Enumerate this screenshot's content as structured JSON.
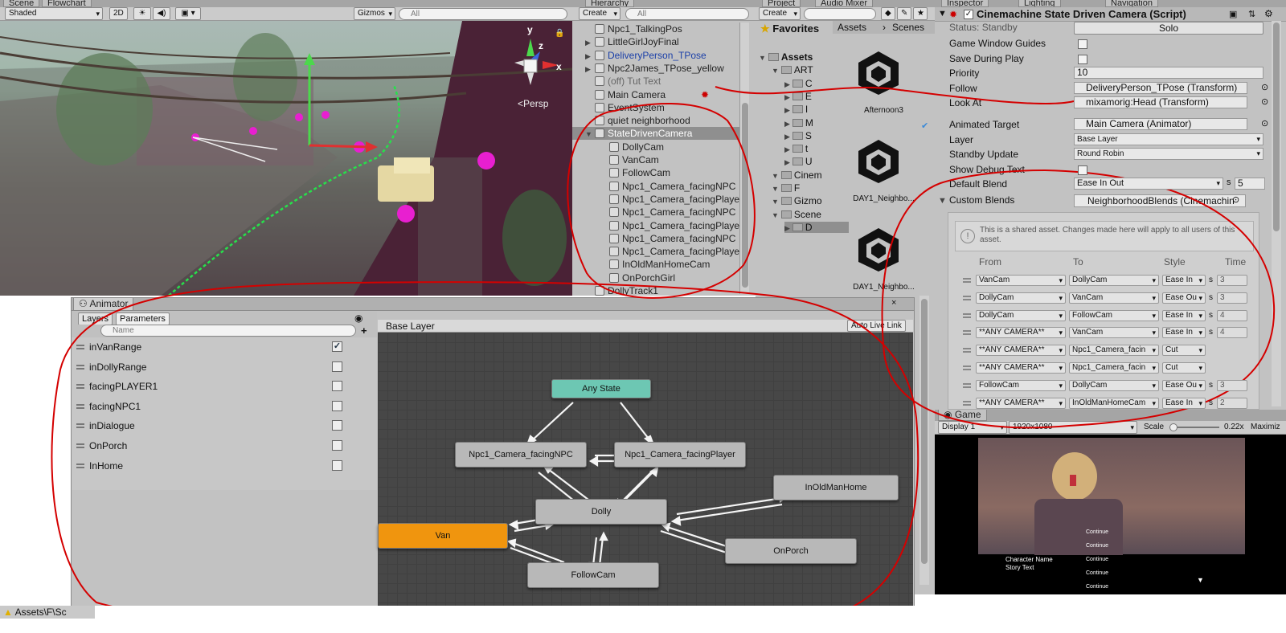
{
  "scene": {
    "tabs": [
      "Scene",
      "Flowchart"
    ],
    "shading": "Shaded",
    "mode_2d": "2D",
    "gizmos": "Gizmos",
    "search_placeholder": "All",
    "persp": "Persp",
    "axes": {
      "x": "x",
      "y": "y",
      "z": "z"
    }
  },
  "hierarchy": {
    "title": "Hierarchy",
    "create": "Create",
    "search_placeholder": "All",
    "items": [
      {
        "label": "Npc1_TalkingPos",
        "indent": 0,
        "expand": false,
        "color": "#222"
      },
      {
        "label": "LittleGirlJoyFinal",
        "indent": 0,
        "expand": true,
        "color": "#222"
      },
      {
        "label": "DeliveryPerson_TPose",
        "indent": 0,
        "expand": true,
        "color": "#1a3fa8"
      },
      {
        "label": "Npc2James_TPose_yellow",
        "indent": 0,
        "expand": true,
        "color": "#222"
      },
      {
        "label": "(off) Tut Text",
        "indent": 0,
        "expand": false,
        "color": "#666"
      },
      {
        "label": "Main Camera",
        "indent": 0,
        "expand": false,
        "color": "#222"
      },
      {
        "label": "EventSystem",
        "indent": 0,
        "expand": false,
        "color": "#222"
      },
      {
        "label": "quiet neighborhood",
        "indent": 0,
        "expand": false,
        "color": "#222"
      },
      {
        "label": "StateDrivenCamera",
        "indent": 0,
        "expand": true,
        "color": "#fff",
        "selected": true
      },
      {
        "label": "DollyCam",
        "indent": 1,
        "color": "#222"
      },
      {
        "label": "VanCam",
        "indent": 1,
        "color": "#222"
      },
      {
        "label": "FollowCam",
        "indent": 1,
        "color": "#222"
      },
      {
        "label": "Npc1_Camera_facingNPC",
        "indent": 1,
        "color": "#222"
      },
      {
        "label": "Npc1_Camera_facingPlayer",
        "indent": 1,
        "color": "#222"
      },
      {
        "label": "Npc1_Camera_facingNPC",
        "indent": 1,
        "color": "#222"
      },
      {
        "label": "Npc1_Camera_facingPlayer",
        "indent": 1,
        "color": "#222"
      },
      {
        "label": "Npc1_Camera_facingNPC",
        "indent": 1,
        "color": "#222"
      },
      {
        "label": "Npc1_Camera_facingPlayer",
        "indent": 1,
        "color": "#222"
      },
      {
        "label": "InOldManHomeCam",
        "indent": 1,
        "color": "#222"
      },
      {
        "label": "OnPorchGirl",
        "indent": 1,
        "color": "#222"
      },
      {
        "label": "DollyTrack1",
        "indent": 0,
        "color": "#222"
      }
    ]
  },
  "project": {
    "tabs": [
      "Project",
      "Audio Mixer"
    ],
    "create": "Create",
    "favorites": "Favorites",
    "breadcrumb": [
      "Assets",
      "Scenes"
    ],
    "tree": [
      {
        "label": "Assets",
        "indent": 0,
        "bold": true
      },
      {
        "label": "ART",
        "indent": 1
      },
      {
        "label": "C",
        "indent": 2
      },
      {
        "label": "E",
        "indent": 2
      },
      {
        "label": "I",
        "indent": 2
      },
      {
        "label": "M",
        "indent": 2
      },
      {
        "label": "S",
        "indent": 2
      },
      {
        "label": "t",
        "indent": 2
      },
      {
        "label": "U",
        "indent": 2
      },
      {
        "label": "Cinem",
        "indent": 1
      },
      {
        "label": "F",
        "indent": 1
      },
      {
        "label": "Gizmo",
        "indent": 1
      },
      {
        "label": "Scene",
        "indent": 1
      },
      {
        "label": "D",
        "indent": 2
      }
    ],
    "assets": [
      "Afternoon3",
      "DAY1_Neighbo...",
      "DAY1_Neighbo..."
    ]
  },
  "inspector": {
    "tabs": [
      "Inspector",
      "Lighting",
      "Navigation"
    ],
    "component": "Cinemachine State Driven Camera (Script)",
    "status": "Status: Standby",
    "solo": "Solo",
    "rows": [
      {
        "label": "Game Window Guides",
        "type": "check",
        "value": false
      },
      {
        "label": "Save During Play",
        "type": "check",
        "value": false
      },
      {
        "label": "Priority",
        "type": "text",
        "value": "10"
      },
      {
        "label": "Follow",
        "type": "obj",
        "value": "DeliveryPerson_TPose (Transform)"
      },
      {
        "label": "Look At",
        "type": "obj",
        "value": "mixamorig:Head (Transform)"
      },
      {
        "label": "Animated Target",
        "type": "obj",
        "value": "Main Camera (Animator)"
      },
      {
        "label": "Layer",
        "type": "drop",
        "value": "Base Layer"
      },
      {
        "label": "Standby Update",
        "type": "drop",
        "value": "Round Robin"
      },
      {
        "label": "Show Debug Text",
        "type": "check",
        "value": false
      },
      {
        "label": "Default Blend",
        "type": "blend",
        "value": "Ease In Out",
        "time": "5"
      }
    ],
    "custom_blends": {
      "label": "Custom Blends",
      "value": "NeighborhoodBlends (Cinemachin",
      "notice": "This is a shared asset.  Changes made here will apply to all users of this asset.",
      "headers": [
        "From",
        "To",
        "Style",
        "Time"
      ],
      "rows": [
        {
          "from": "VanCam",
          "to": "DollyCam",
          "style": "Ease In",
          "time": "3"
        },
        {
          "from": "DollyCam",
          "to": "VanCam",
          "style": "Ease Ou",
          "time": "3"
        },
        {
          "from": "DollyCam",
          "to": "FollowCam",
          "style": "Ease In",
          "time": "4"
        },
        {
          "from": "**ANY CAMERA**",
          "to": "VanCam",
          "style": "Ease In",
          "time": "4"
        },
        {
          "from": "**ANY CAMERA**",
          "to": "Npc1_Camera_facin",
          "style": "Cut",
          "time": ""
        },
        {
          "from": "**ANY CAMERA**",
          "to": "Npc1_Camera_facin",
          "style": "Cut",
          "time": ""
        },
        {
          "from": "FollowCam",
          "to": "DollyCam",
          "style": "Ease Ou",
          "time": "3"
        },
        {
          "from": "**ANY CAMERA**",
          "to": "InOldManHomeCam",
          "style": "Ease In",
          "time": "2"
        }
      ],
      "s": "s"
    }
  },
  "game": {
    "tab": "Game",
    "display": "Display 1",
    "resolution": "1920x1080",
    "scale_label": "Scale",
    "scale": "0.22x",
    "maximize": "Maximiz",
    "dialogue": {
      "name": "Character Name",
      "story": "Story Text",
      "options": [
        "Continue",
        "Continue",
        "Continue",
        "Continue",
        "Continue"
      ]
    }
  },
  "animator": {
    "tab": "Animator",
    "subtabs": [
      "Layers",
      "Parameters"
    ],
    "search_placeholder": "Name",
    "layer": "Base Layer",
    "auto_live_link": "Auto Live Link",
    "params": [
      {
        "name": "inVanRange",
        "value": true
      },
      {
        "name": "inDollyRange",
        "value": false
      },
      {
        "name": "facingPLAYER1",
        "value": false
      },
      {
        "name": "facingNPC1",
        "value": false
      },
      {
        "name": "inDialogue",
        "value": false
      },
      {
        "name": "OnPorch",
        "value": false
      },
      {
        "name": "InHome",
        "value": false
      }
    ],
    "states": [
      {
        "name": "Any State",
        "kind": "any"
      },
      {
        "name": "Npc1_Camera_facingNPC",
        "kind": "state"
      },
      {
        "name": "Npc1_Camera_facingPlayer",
        "kind": "state"
      },
      {
        "name": "Dolly",
        "kind": "state"
      },
      {
        "name": "InOldManHome",
        "kind": "state"
      },
      {
        "name": "Van",
        "kind": "default"
      },
      {
        "name": "OnPorch",
        "kind": "state"
      },
      {
        "name": "FollowCam",
        "kind": "state"
      }
    ]
  },
  "status_bar": {
    "path": "Assets\\F\\Sc"
  },
  "colors": {
    "annotation": "#d40000",
    "selected_row": "#8f8f8f",
    "any_state": "#6dc7b3",
    "default_state": "#f0950e",
    "state": "#b8b8b8"
  }
}
